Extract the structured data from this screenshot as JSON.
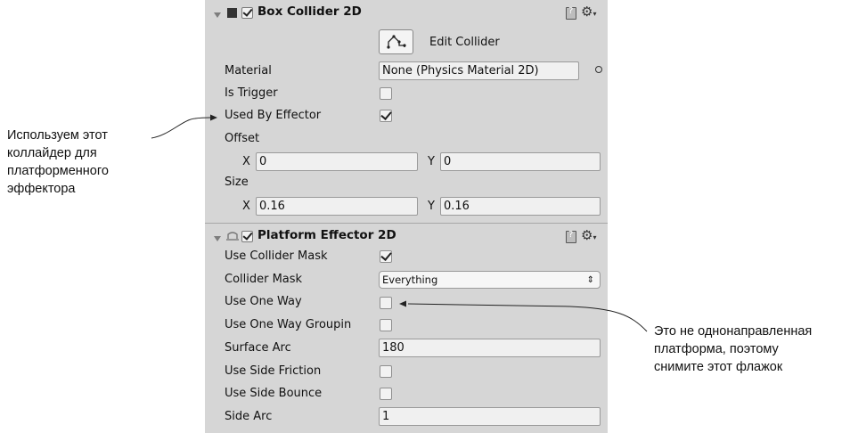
{
  "box_collider": {
    "title": "Box Collider 2D",
    "enabled": true,
    "edit_collider_label": "Edit Collider",
    "material_label": "Material",
    "material_value": "None (Physics Material 2D)",
    "is_trigger_label": "Is Trigger",
    "is_trigger": false,
    "used_by_effector_label": "Used By Effector",
    "used_by_effector": true,
    "offset_label": "Offset",
    "offset_x": "0",
    "offset_y": "0",
    "size_label": "Size",
    "size_x": "0.16",
    "size_y": "0.16",
    "x_label": "X",
    "y_label": "Y"
  },
  "platform_effector": {
    "title": "Platform Effector 2D",
    "enabled": true,
    "use_collider_mask_label": "Use Collider Mask",
    "use_collider_mask": true,
    "collider_mask_label": "Collider Mask",
    "collider_mask_value": "Everything",
    "use_one_way_label": "Use One Way",
    "use_one_way": false,
    "use_one_way_grouping_label": "Use One Way Groupin",
    "use_one_way_grouping": false,
    "surface_arc_label": "Surface Arc",
    "surface_arc_value": "180",
    "use_side_friction_label": "Use Side Friction",
    "use_side_friction": false,
    "use_side_bounce_label": "Use Side Bounce",
    "use_side_bounce": false,
    "side_arc_label": "Side Arc",
    "side_arc_value": "1"
  },
  "annotations": {
    "left_lines": [
      "Используем этот",
      "коллайдер для",
      "платформенного",
      "эффектора"
    ],
    "right_lines": [
      "Это не однонаправленная",
      "платформа, поэтому",
      "снимите этот флажок"
    ]
  },
  "icons": {
    "foldout": "triangle-down-icon",
    "component_box": "square-icon",
    "component_effector": "platform-effector-icon",
    "help": "help-book-icon",
    "settings": "gear-icon",
    "edit_collider": "polygon-edit-icon",
    "object_picker": "target-circle-icon"
  }
}
